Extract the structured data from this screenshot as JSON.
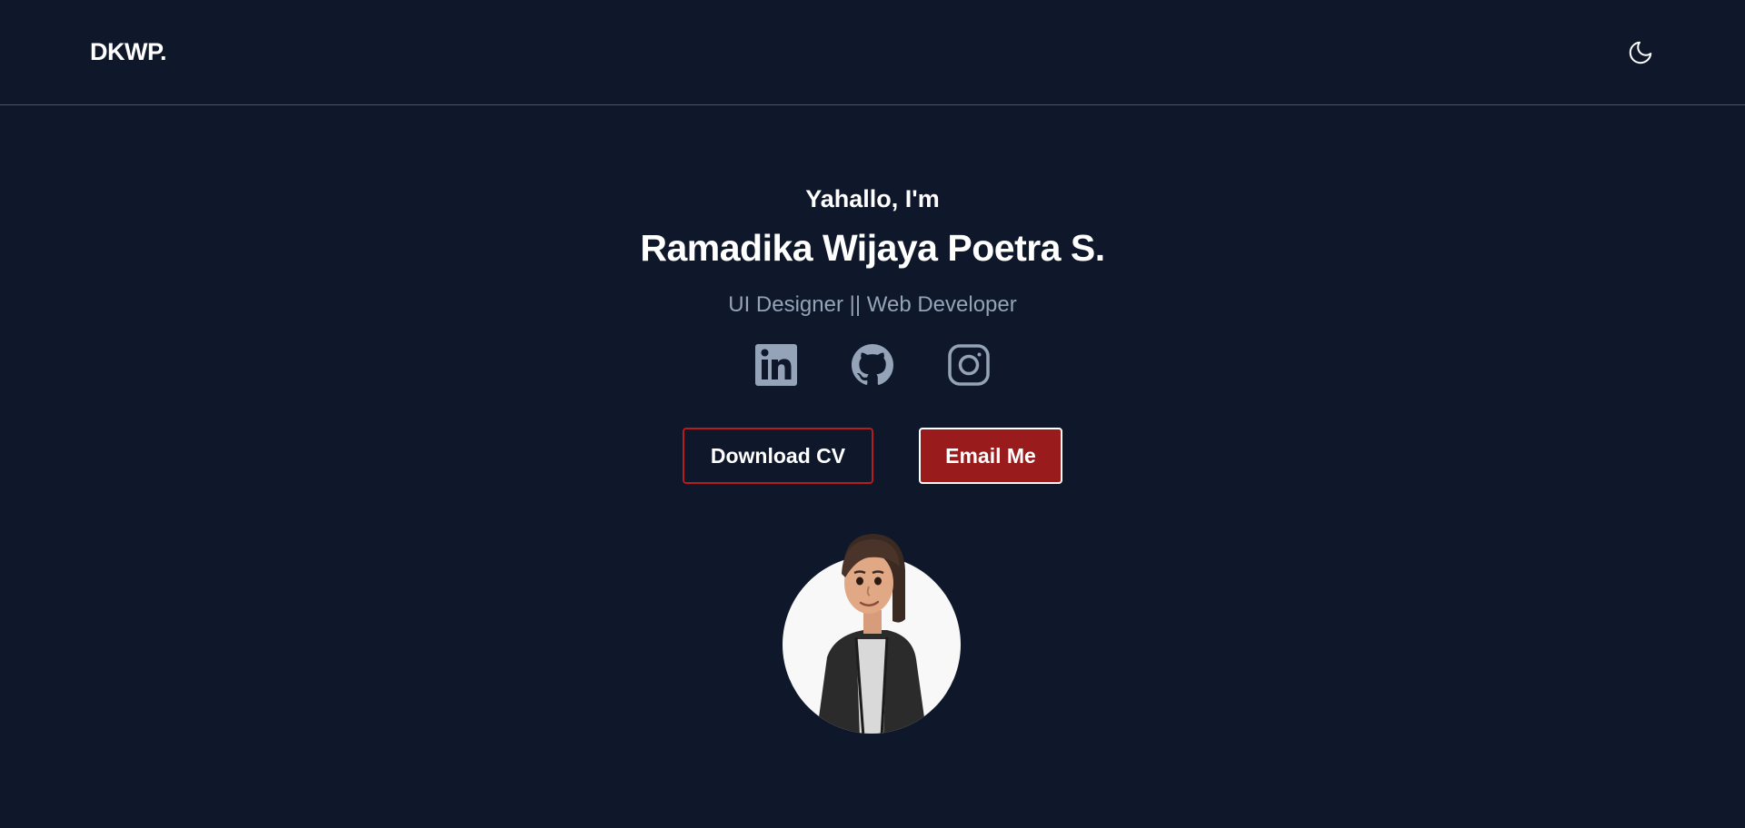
{
  "navbar": {
    "logo": "DKWP.",
    "theme_toggle_icon": "moon-icon"
  },
  "hero": {
    "greeting": "Yahallo, I'm",
    "name": "Ramadika Wijaya Poetra S.",
    "role": "UI Designer || Web Developer",
    "socials": [
      {
        "icon": "linkedin-icon"
      },
      {
        "icon": "github-icon"
      },
      {
        "icon": "instagram-icon"
      }
    ],
    "download_cv_label": "Download CV",
    "email_me_label": "Email Me"
  },
  "colors": {
    "background": "#0f172a",
    "accent": "#991b1b",
    "muted_text": "#94a3b8",
    "icon": "#94a3b8"
  }
}
